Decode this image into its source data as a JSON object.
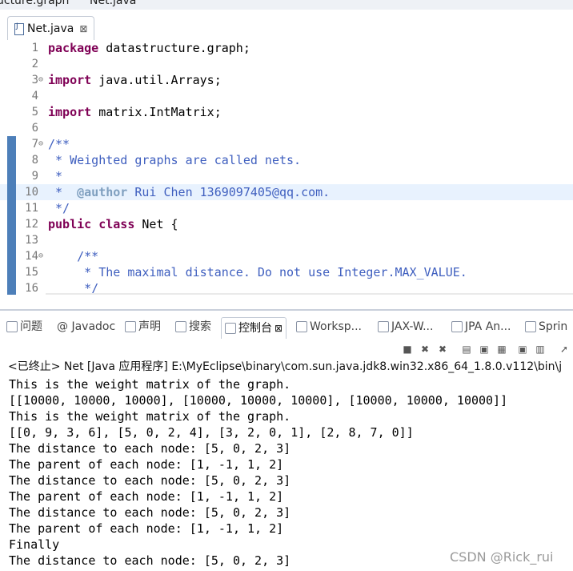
{
  "top_strip": {
    "left": "ucture.graph",
    "right": "Net.java"
  },
  "editor_tab": {
    "label": "Net.java",
    "close": "⊠"
  },
  "editor_lines": [
    {
      "n": "1",
      "fold": "",
      "mark": false,
      "cur": false,
      "parts": [
        [
          "kw",
          "package"
        ],
        [
          "",
          "datastructure.graph;"
        ]
      ]
    },
    {
      "n": "2",
      "fold": "",
      "mark": false,
      "cur": false,
      "parts": []
    },
    {
      "n": "3",
      "fold": "⊖",
      "mark": false,
      "cur": false,
      "parts": [
        [
          "kw",
          "import"
        ],
        [
          "",
          "java.util.Arrays;"
        ]
      ]
    },
    {
      "n": "4",
      "fold": "",
      "mark": false,
      "cur": false,
      "parts": []
    },
    {
      "n": "5",
      "fold": "",
      "mark": false,
      "cur": false,
      "parts": [
        [
          "kw",
          "import"
        ],
        [
          "",
          "matrix.IntMatrix;"
        ]
      ]
    },
    {
      "n": "6",
      "fold": "",
      "mark": false,
      "cur": false,
      "parts": []
    },
    {
      "n": "7",
      "fold": "⊖",
      "mark": true,
      "cur": false,
      "parts": [
        [
          "cm",
          "/**"
        ]
      ]
    },
    {
      "n": "8",
      "fold": "",
      "mark": true,
      "cur": false,
      "parts": [
        [
          "cm",
          " * Weighted graphs are called nets."
        ]
      ]
    },
    {
      "n": "9",
      "fold": "",
      "mark": true,
      "cur": false,
      "parts": [
        [
          "cm",
          " *"
        ]
      ]
    },
    {
      "n": "10",
      "fold": "",
      "mark": true,
      "cur": true,
      "parts": [
        [
          "cm",
          " * "
        ],
        [
          "tag",
          "@author"
        ],
        [
          "cm",
          "Rui Chen 1369097405@qq.com."
        ]
      ]
    },
    {
      "n": "11",
      "fold": "",
      "mark": true,
      "cur": false,
      "parts": [
        [
          "cm",
          " */"
        ]
      ]
    },
    {
      "n": "12",
      "fold": "",
      "mark": true,
      "cur": false,
      "parts": [
        [
          "kw",
          "public"
        ],
        [
          "kw",
          "class"
        ],
        [
          "",
          "Net {"
        ]
      ]
    },
    {
      "n": "13",
      "fold": "",
      "mark": true,
      "cur": false,
      "parts": []
    },
    {
      "n": "14",
      "fold": "⊖",
      "mark": true,
      "cur": false,
      "parts": [
        [
          "cm",
          "    /**"
        ]
      ]
    },
    {
      "n": "15",
      "fold": "",
      "mark": true,
      "cur": false,
      "parts": [
        [
          "cm",
          "     * The maximal distance. Do not use Integer.MAX_VALUE."
        ]
      ]
    },
    {
      "n": "16",
      "fold": "",
      "mark": true,
      "cur": false,
      "parts": [
        [
          "cm",
          "     */"
        ]
      ]
    }
  ],
  "view_tabs": [
    {
      "label": "问题",
      "icon": "problems-icon",
      "active": false
    },
    {
      "label": "@ Javadoc",
      "icon": "",
      "active": false
    },
    {
      "label": "声明",
      "icon": "declaration-icon",
      "active": false
    },
    {
      "label": "搜索",
      "icon": "search-icon",
      "active": false
    },
    {
      "label": "控制台",
      "icon": "console-icon",
      "active": true,
      "close": "⊠"
    },
    {
      "label": "Worksp...",
      "icon": "workspace-icon",
      "active": false
    },
    {
      "label": "JAX-W...",
      "icon": "jaxws-icon",
      "active": false
    },
    {
      "label": "JPA An...",
      "icon": "jpa-icon",
      "active": false
    },
    {
      "label": "Sprin",
      "icon": "spring-icon",
      "active": false
    }
  ],
  "console": {
    "status": "<已终止> Net [Java 应用程序] E:\\MyEclipse\\binary\\com.sun.java.jdk8.win32.x86_64_1.8.0.v112\\bin\\j",
    "lines": [
      "This is the weight matrix of the graph.",
      "[[10000, 10000, 10000], [10000, 10000, 10000], [10000, 10000, 10000]]",
      "This is the weight matrix of the graph.",
      "[[0, 9, 3, 6], [5, 0, 2, 4], [3, 2, 0, 1], [2, 8, 7, 0]]",
      "The distance to each node: [5, 0, 2, 3]",
      "The parent of each node: [1, -1, 1, 2]",
      "The distance to each node: [5, 0, 2, 3]",
      "The parent of each node: [1, -1, 1, 2]",
      "The distance to each node: [5, 0, 2, 3]",
      "The parent of each node: [1, -1, 1, 2]",
      "Finally",
      "The distance to each node: [5, 0, 2, 3]"
    ]
  },
  "watermark": "CSDN @Rick_rui"
}
